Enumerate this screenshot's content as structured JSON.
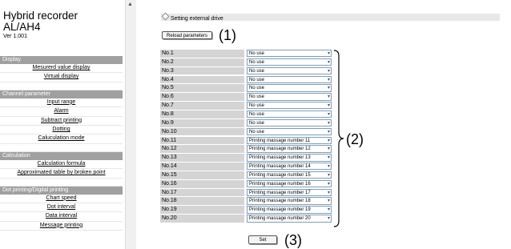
{
  "app": {
    "title": "Hybrid recorder",
    "model": "AL/AH4",
    "version": "Ver 1.001"
  },
  "sidebar": {
    "sections": [
      {
        "title": "Display",
        "items": [
          "Mesurerd value display",
          "Virtual display"
        ]
      },
      {
        "title": "Channel parameter",
        "items": [
          "Input range",
          "Alarm",
          "Subtract printing",
          "Dotting",
          "Caluculation mode"
        ]
      },
      {
        "title": "Calculation",
        "items": [
          "Calculation formula",
          "Approximated table by broken point"
        ]
      },
      {
        "title": "Dot printing/Digital printing",
        "items": [
          "Chart speed",
          "Dot interval",
          "Data interval",
          "Message printing"
        ]
      }
    ]
  },
  "main": {
    "heading": "Setting external drive",
    "reload_label": "Reload parameters",
    "set_label": "Set",
    "callouts": {
      "reload": "(1)",
      "rows": "(2)",
      "set": "(3)"
    },
    "rows": [
      {
        "label": "No.1",
        "value": "No use"
      },
      {
        "label": "No.2",
        "value": "No use"
      },
      {
        "label": "No.3",
        "value": "No use"
      },
      {
        "label": "No.4",
        "value": "No use"
      },
      {
        "label": "No.5",
        "value": "No use"
      },
      {
        "label": "No.6",
        "value": "No use"
      },
      {
        "label": "No.7",
        "value": "No use"
      },
      {
        "label": "No.8",
        "value": "No use"
      },
      {
        "label": "No.9",
        "value": "No use"
      },
      {
        "label": "No.10",
        "value": "No use"
      },
      {
        "label": "No.11",
        "value": "Printing massage number 11"
      },
      {
        "label": "No.12",
        "value": "Printing massage number 12"
      },
      {
        "label": "No.13",
        "value": "Printing massage number 13"
      },
      {
        "label": "No.14",
        "value": "Printing massage number 14"
      },
      {
        "label": "No.15",
        "value": "Printing massage number 15"
      },
      {
        "label": "No.16",
        "value": "Printing massage number 16"
      },
      {
        "label": "No.17",
        "value": "Printing massage number 17"
      },
      {
        "label": "No.18",
        "value": "Printing massage number 18"
      },
      {
        "label": "No.19",
        "value": "Printing massage number 19"
      },
      {
        "label": "No.20",
        "value": "Printing massage number 20"
      }
    ]
  }
}
